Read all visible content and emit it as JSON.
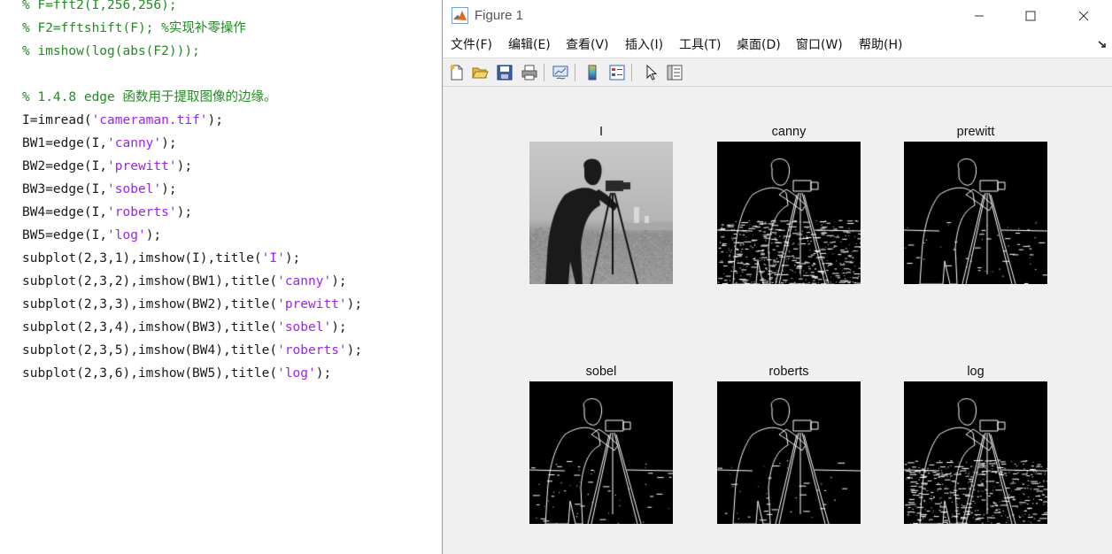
{
  "editor": {
    "lines": [
      [
        {
          "t": "% F=fft2(I,256,256);",
          "c": "comment"
        }
      ],
      [
        {
          "t": "% F2=fftshift(F); %实现补零操作",
          "c": "comment"
        }
      ],
      [
        {
          "t": "% imshow(log(abs(F2)));",
          "c": "comment"
        }
      ],
      [],
      [
        {
          "t": "% 1.4.8 edge 函数用于提取图像的边缘。",
          "c": "comment"
        }
      ],
      [
        {
          "t": "I=imread(",
          "c": "code"
        },
        {
          "t": "'cameraman.tif'",
          "c": "string"
        },
        {
          "t": ");",
          "c": "code"
        }
      ],
      [
        {
          "t": "BW1=edge(I,",
          "c": "code"
        },
        {
          "t": "'canny'",
          "c": "string"
        },
        {
          "t": ");",
          "c": "code"
        }
      ],
      [
        {
          "t": "BW2=edge(I,",
          "c": "code"
        },
        {
          "t": "'prewitt'",
          "c": "string"
        },
        {
          "t": ");",
          "c": "code"
        }
      ],
      [
        {
          "t": "BW3=edge(I,",
          "c": "code"
        },
        {
          "t": "'sobel'",
          "c": "string"
        },
        {
          "t": ");",
          "c": "code"
        }
      ],
      [
        {
          "t": "BW4=edge(I,",
          "c": "code"
        },
        {
          "t": "'roberts'",
          "c": "string"
        },
        {
          "t": ");",
          "c": "code"
        }
      ],
      [
        {
          "t": "BW5=edge(I,",
          "c": "code"
        },
        {
          "t": "'log'",
          "c": "string"
        },
        {
          "t": ");",
          "c": "code"
        }
      ],
      [
        {
          "t": "subplot(2,3,1),imshow(I),title(",
          "c": "code"
        },
        {
          "t": "'I'",
          "c": "string"
        },
        {
          "t": ");",
          "c": "code"
        }
      ],
      [
        {
          "t": "subplot(2,3,2),imshow(BW1),title(",
          "c": "code"
        },
        {
          "t": "'canny'",
          "c": "string"
        },
        {
          "t": ");",
          "c": "code"
        }
      ],
      [
        {
          "t": "subplot(2,3,3),imshow(BW2),title(",
          "c": "code"
        },
        {
          "t": "'prewitt'",
          "c": "string"
        },
        {
          "t": ");",
          "c": "code"
        }
      ],
      [
        {
          "t": "subplot(2,3,4),imshow(BW3),title(",
          "c": "code"
        },
        {
          "t": "'sobel'",
          "c": "string"
        },
        {
          "t": ");",
          "c": "code"
        }
      ],
      [
        {
          "t": "subplot(2,3,5),imshow(BW4),title(",
          "c": "code"
        },
        {
          "t": "'roberts'",
          "c": "string"
        },
        {
          "t": ");",
          "c": "code"
        }
      ],
      [
        {
          "t": "subplot(2,3,6),imshow(BW5),title(",
          "c": "code"
        },
        {
          "t": "'log'",
          "c": "string"
        },
        {
          "t": ");",
          "c": "code"
        }
      ]
    ]
  },
  "figure": {
    "title": "Figure 1",
    "window_buttons": [
      "minimize-icon",
      "maximize-icon",
      "close-icon"
    ],
    "menu": [
      "文件(F)",
      "编辑(E)",
      "查看(V)",
      "插入(I)",
      "工具(T)",
      "桌面(D)",
      "窗口(W)",
      "帮助(H)"
    ],
    "toolbar": [
      "new-figure-icon",
      "open-file-icon",
      "save-icon",
      "print-icon",
      "link-plot-icon",
      "colorbar-icon",
      "legend-icon",
      "select-arrow-icon",
      "property-editor-icon"
    ],
    "subplots": [
      {
        "title": "I",
        "kind": "grayscale"
      },
      {
        "title": "canny",
        "kind": "edges"
      },
      {
        "title": "prewitt",
        "kind": "edges"
      },
      {
        "title": "sobel",
        "kind": "edges"
      },
      {
        "title": "roberts",
        "kind": "edges"
      },
      {
        "title": "log",
        "kind": "edges"
      }
    ]
  },
  "colors": {
    "comment": "#228b22",
    "string": "#a020f0",
    "code": "#1a1a1a",
    "figure_bg": "#f0f0f0"
  }
}
